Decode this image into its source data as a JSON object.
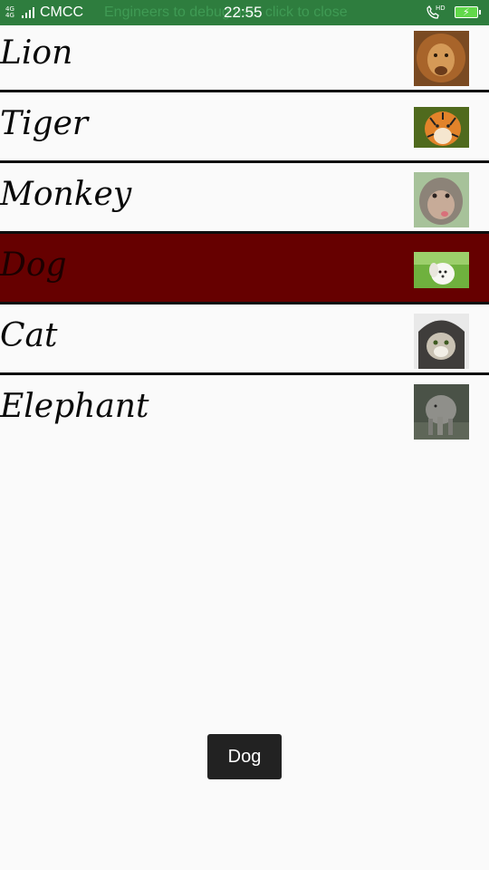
{
  "status_bar": {
    "network_type": "4G 4G",
    "carrier": "CMCC",
    "notice": "Engineers to debug use, click to close",
    "time": "22:55",
    "call_badge": "HD",
    "battery_icon": "battery-charging-icon",
    "colors": {
      "background": "#2e7d3e",
      "notice": "#3f9a54",
      "battery": "#61d84a"
    }
  },
  "list": {
    "items": [
      {
        "label": "Lion",
        "thumb_icon": "lion-thumbnail",
        "selected": false
      },
      {
        "label": "Tiger",
        "thumb_icon": "tiger-thumbnail",
        "selected": false
      },
      {
        "label": "Monkey",
        "thumb_icon": "monkey-thumbnail",
        "selected": false
      },
      {
        "label": "Dog",
        "thumb_icon": "dog-thumbnail",
        "selected": true
      },
      {
        "label": "Cat",
        "thumb_icon": "cat-thumbnail",
        "selected": false
      },
      {
        "label": "Elephant",
        "thumb_icon": "elephant-thumbnail",
        "selected": false
      }
    ],
    "colors": {
      "selected_background": "#660000",
      "divider": "#0e0e0e"
    }
  },
  "toast": {
    "text": "Dog"
  }
}
